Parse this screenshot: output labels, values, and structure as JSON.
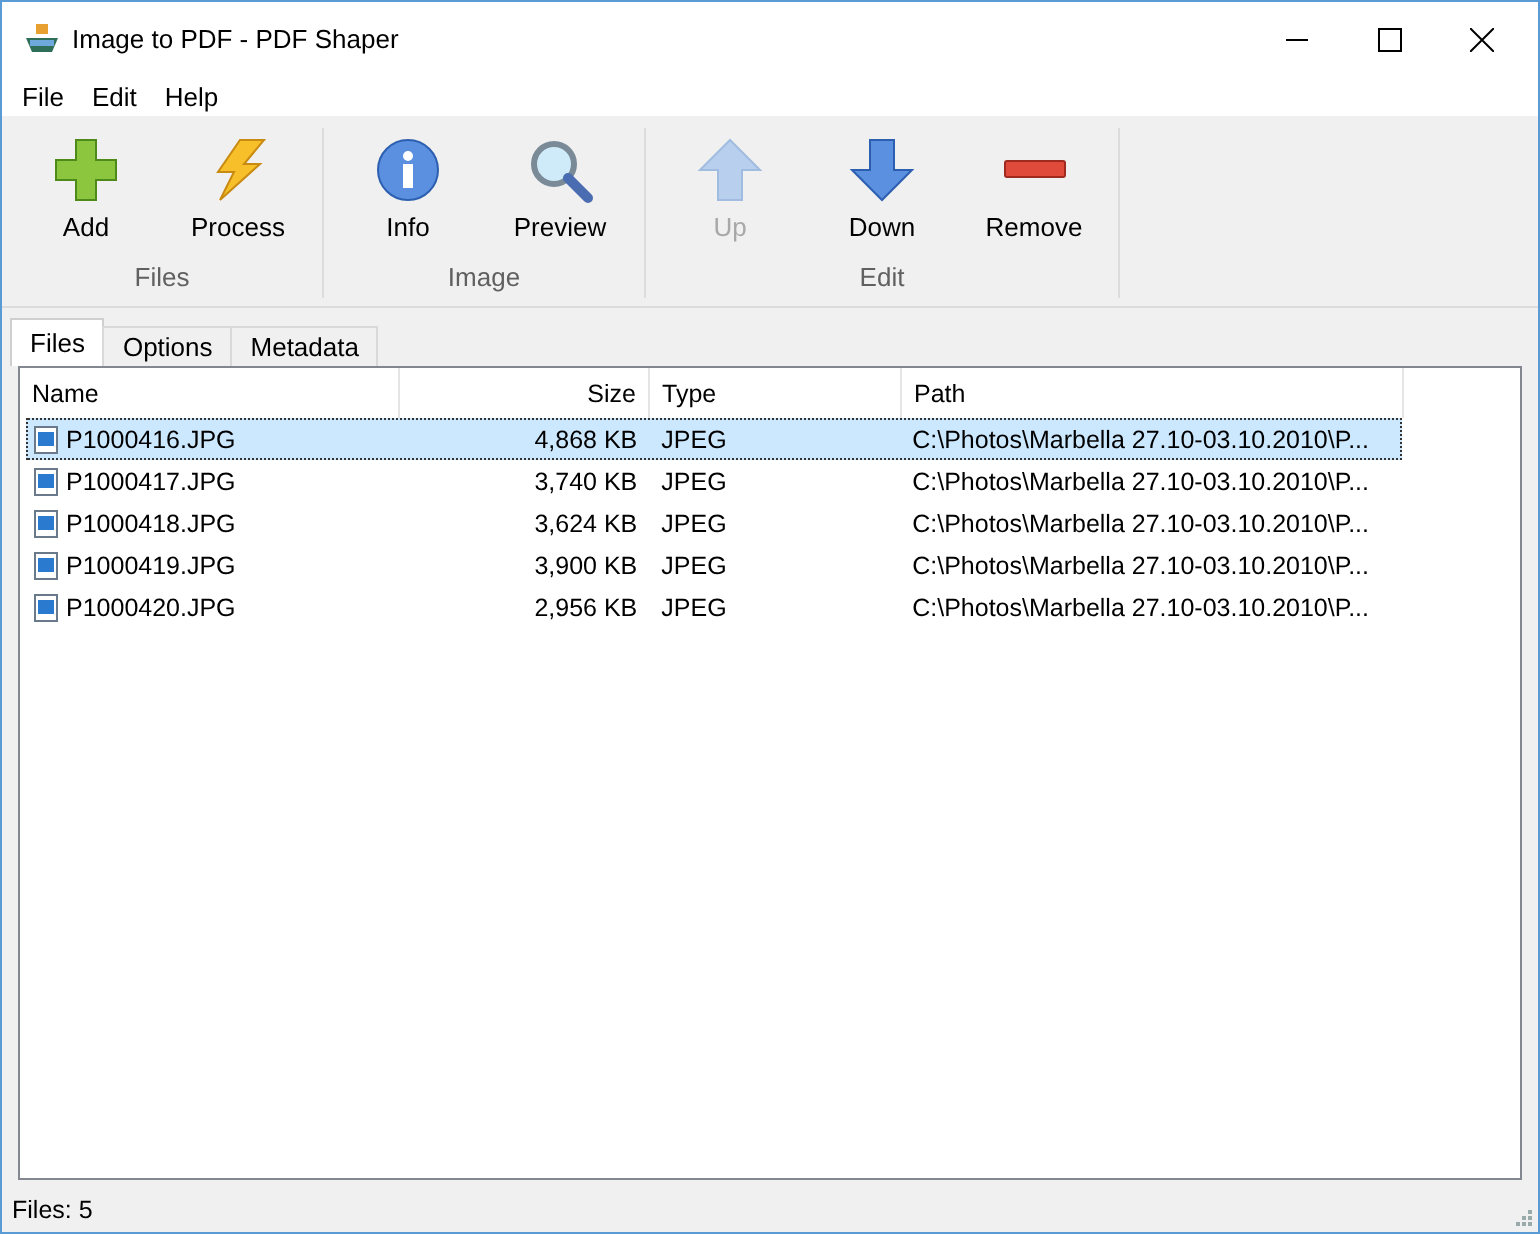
{
  "window": {
    "title": "Image to PDF - PDF Shaper"
  },
  "menu": [
    "File",
    "Edit",
    "Help"
  ],
  "toolbar": {
    "groups": [
      {
        "label": "Files",
        "buttons": [
          {
            "kind": "add",
            "label": "Add",
            "disabled": false
          },
          {
            "kind": "process",
            "label": "Process",
            "disabled": false
          }
        ]
      },
      {
        "label": "Image",
        "buttons": [
          {
            "kind": "info",
            "label": "Info",
            "disabled": false
          },
          {
            "kind": "preview",
            "label": "Preview",
            "disabled": false
          }
        ]
      },
      {
        "label": "Edit",
        "buttons": [
          {
            "kind": "up",
            "label": "Up",
            "disabled": true
          },
          {
            "kind": "down",
            "label": "Down",
            "disabled": false
          },
          {
            "kind": "remove",
            "label": "Remove",
            "disabled": false
          }
        ]
      }
    ]
  },
  "tabs": [
    {
      "label": "Files",
      "selected": true
    },
    {
      "label": "Options",
      "selected": false
    },
    {
      "label": "Metadata",
      "selected": false
    }
  ],
  "table": {
    "columns": [
      "Name",
      "Size",
      "Type",
      "Path"
    ],
    "rows": [
      {
        "name": "P1000416.JPG",
        "size": "4,868 KB",
        "type": "JPEG",
        "path": "C:\\Photos\\Marbella 27.10-03.10.2010\\P...",
        "selected": true
      },
      {
        "name": "P1000417.JPG",
        "size": "3,740 KB",
        "type": "JPEG",
        "path": "C:\\Photos\\Marbella 27.10-03.10.2010\\P...",
        "selected": false
      },
      {
        "name": "P1000418.JPG",
        "size": "3,624 KB",
        "type": "JPEG",
        "path": "C:\\Photos\\Marbella 27.10-03.10.2010\\P...",
        "selected": false
      },
      {
        "name": "P1000419.JPG",
        "size": "3,900 KB",
        "type": "JPEG",
        "path": "C:\\Photos\\Marbella 27.10-03.10.2010\\P...",
        "selected": false
      },
      {
        "name": "P1000420.JPG",
        "size": "2,956 KB",
        "type": "JPEG",
        "path": "C:\\Photos\\Marbella 27.10-03.10.2010\\P...",
        "selected": false
      }
    ]
  },
  "status_bar": "Files: 5"
}
